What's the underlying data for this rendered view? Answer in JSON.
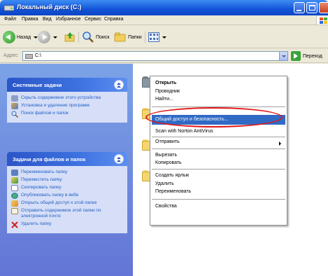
{
  "window": {
    "title": "Локальный диск (C:)"
  },
  "menubar": {
    "items": [
      "Файл",
      "Правка",
      "Вид",
      "Избранное",
      "Сервис",
      "Справка"
    ]
  },
  "toolbar": {
    "back_label": "Назад",
    "search_label": "Поиск",
    "folders_label": "Папки"
  },
  "address": {
    "label": "Адрес:",
    "value": "C:\\",
    "go_label": "Переход"
  },
  "system_tasks": {
    "title": "Системные задачи",
    "items": [
      "Скрыть содержимое этого устройства",
      "Установка и удаление программ",
      "Поиск файлов и папок"
    ]
  },
  "file_tasks": {
    "title": "Задачи для файлов и папок",
    "items": [
      "Переименовать папку",
      "Переместить папку",
      "Скопировать папку",
      "Опубликовать папку в вебе",
      "Открыть общий доступ к этой папке",
      "Отправить содержимое этой папки по электронной почте",
      "Удалить папку"
    ]
  },
  "context_menu": {
    "open": "Открыть",
    "explorer": "Проводник",
    "find": "Найти...",
    "sharing": "Общий доступ и безопасность...",
    "scan": "Scan with Norton AntiVirus",
    "send_to": "Отправить",
    "cut": "Вырезать",
    "copy": "Копировать",
    "create_shortcut": "Создать ярлык",
    "delete": "Удалить",
    "rename": "Переименовать",
    "properties": "Свойства"
  },
  "colors": {
    "highlight": "#316ac5",
    "annotation_oval": "#e01818",
    "task_link": "#215dc6",
    "folder": "#f5d66c"
  }
}
